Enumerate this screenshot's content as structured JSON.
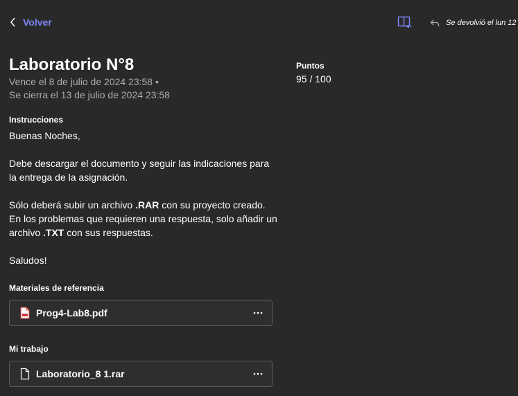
{
  "header": {
    "back_label": "Volver",
    "returned_text": "Se devolvió el lun 12"
  },
  "assignment": {
    "title": "Laboratorio N°8",
    "due": "Vence el 8 de julio de 2024 23:58 •",
    "closes": "Se cierra el 13 de julio de 2024 23:58"
  },
  "points": {
    "label": "Puntos",
    "value": "95 / 100"
  },
  "instructions": {
    "label": "Instrucciones",
    "greeting": "Buenas Noches,",
    "line1": "Debe descargar el documento y seguir las indicaciones para",
    "line2": "la entrega de la asignación.",
    "p2_pre": "Sólo deberá subir un archivo ",
    "p2_bold1": ".RAR",
    "p2_mid": " con su proyecto creado.",
    "p2_line2": "En los problemas que requieren una respuesta, solo añadir un",
    "p2_pre2": "archivo ",
    "p2_bold2": ".TXT",
    "p2_post": " con sus respuestas.",
    "closing": "Saludos!"
  },
  "reference": {
    "label": "Materiales de referencia",
    "file_name": "Prog4-Lab8.pdf",
    "more_label": "···"
  },
  "my_work": {
    "label": "Mi trabajo",
    "file_name": "Laboratorio_8 1.rar",
    "more_label": "···"
  },
  "colors": {
    "background": "#292929",
    "accent": "#7f85f5",
    "muted_text": "#adadad",
    "card_border": "#5c5c5c",
    "pdf_red": "#d13438"
  },
  "icons": [
    "chevron-left-icon",
    "immersive-reader-icon",
    "reply-icon",
    "pdf-file-icon",
    "file-icon",
    "more-icon"
  ]
}
